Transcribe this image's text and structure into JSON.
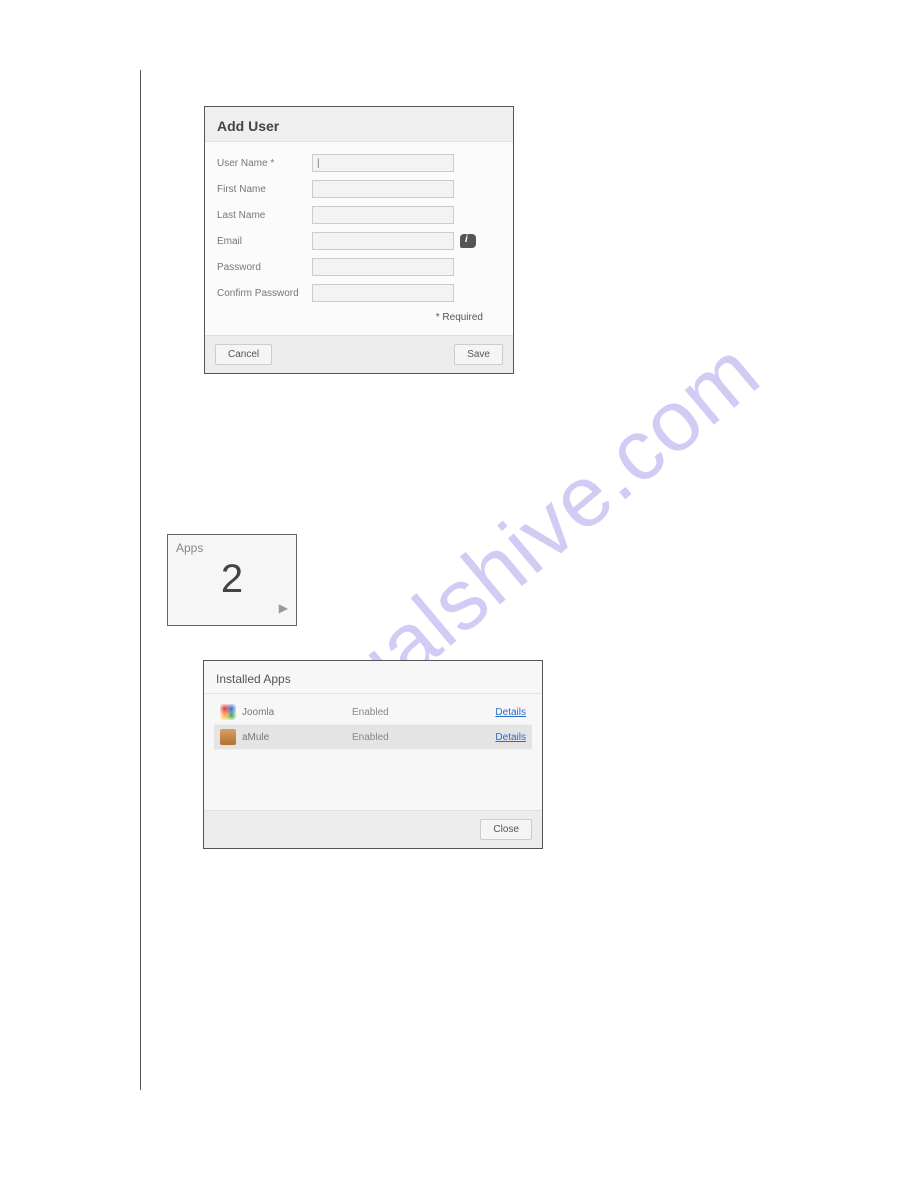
{
  "addUser": {
    "title": "Add User",
    "fields": {
      "userName": {
        "label": "User Name *",
        "value": "|"
      },
      "firstName": {
        "label": "First Name",
        "value": ""
      },
      "lastName": {
        "label": "Last Name",
        "value": ""
      },
      "email": {
        "label": "Email",
        "value": ""
      },
      "password": {
        "label": "Password",
        "value": ""
      },
      "confirm": {
        "label": "Confirm Password",
        "value": ""
      }
    },
    "requiredNote": "* Required",
    "cancelLabel": "Cancel",
    "saveLabel": "Save"
  },
  "appsTile": {
    "title": "Apps",
    "count": "2"
  },
  "installedApps": {
    "title": "Installed Apps",
    "rows": [
      {
        "name": "Joomla",
        "status": "Enabled",
        "details": "Details"
      },
      {
        "name": "aMule",
        "status": "Enabled",
        "details": "Details"
      }
    ],
    "closeLabel": "Close"
  },
  "watermark": "manualshive.com"
}
